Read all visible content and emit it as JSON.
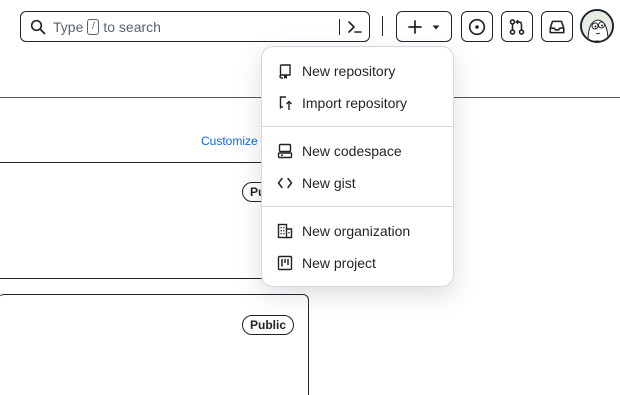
{
  "header": {
    "search": {
      "prefix": "Type",
      "key": "/",
      "suffix": "to search"
    },
    "new_button_icon": "plus-icon",
    "icons": [
      "search-icon",
      "command-palette-icon",
      "plus-icon",
      "triangle-down-icon",
      "issue-opened-icon",
      "git-pull-request-icon",
      "inbox-icon"
    ]
  },
  "dashboard": {
    "customize_link": "Customize your pins",
    "repo_cards": [
      {
        "visibility": "Public"
      },
      {
        "visibility": "Public"
      }
    ]
  },
  "create_menu": {
    "groups": [
      {
        "items": [
          {
            "label": "New repository",
            "icon": "repo-icon"
          },
          {
            "label": "Import repository",
            "icon": "repo-push-icon"
          }
        ]
      },
      {
        "items": [
          {
            "label": "New codespace",
            "icon": "codespaces-icon"
          },
          {
            "label": "New gist",
            "icon": "code-icon"
          }
        ]
      },
      {
        "items": [
          {
            "label": "New organization",
            "icon": "organization-icon"
          },
          {
            "label": "New project",
            "icon": "project-icon"
          }
        ]
      }
    ]
  },
  "colors": {
    "text": "#1f2328",
    "muted": "#59636e",
    "link": "#0969da",
    "border": "#d1d9e0"
  }
}
